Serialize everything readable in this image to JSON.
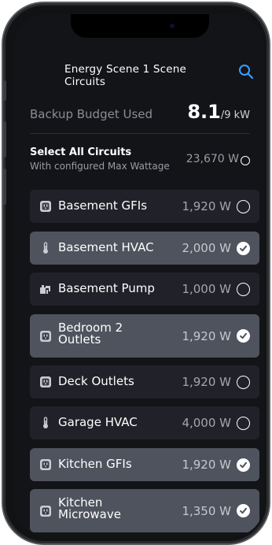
{
  "header": {
    "title": "Energy Scene 1 Scene Circuits"
  },
  "budget": {
    "label": "Backup Budget Used",
    "used": "8.1",
    "total": "/9 kW"
  },
  "select_all": {
    "title": "Select All Circuits",
    "subtitle": "With configured Max Wattage",
    "wattage": "23,670 W",
    "selected": false
  },
  "circuits": [
    {
      "label": "Basement GFIs",
      "wattage": "1,920 W",
      "selected": false,
      "icon": "outlet-icon"
    },
    {
      "label": "Basement HVAC",
      "wattage": "2,000 W",
      "selected": true,
      "icon": "thermometer-icon"
    },
    {
      "label": "Basement Pump",
      "wattage": "1,000 W",
      "selected": false,
      "icon": "pump-icon"
    },
    {
      "label": "Bedroom 2 Outlets",
      "wattage": "1,920 W",
      "selected": true,
      "icon": "outlet-icon"
    },
    {
      "label": "Deck Outlets",
      "wattage": "1,920 W",
      "selected": false,
      "icon": "outlet-icon"
    },
    {
      "label": "Garage HVAC",
      "wattage": "4,000 W",
      "selected": false,
      "icon": "thermometer-icon"
    },
    {
      "label": "Kitchen GFIs",
      "wattage": "1,920 W",
      "selected": true,
      "icon": "outlet-icon"
    },
    {
      "label": "Kitchen Microwave",
      "wattage": "1,350 W",
      "selected": true,
      "icon": "outlet-icon"
    }
  ],
  "colors": {
    "accent": "#3aa0ff",
    "row_off": "#212229",
    "row_on": "#4f535e",
    "background": "#131418"
  }
}
